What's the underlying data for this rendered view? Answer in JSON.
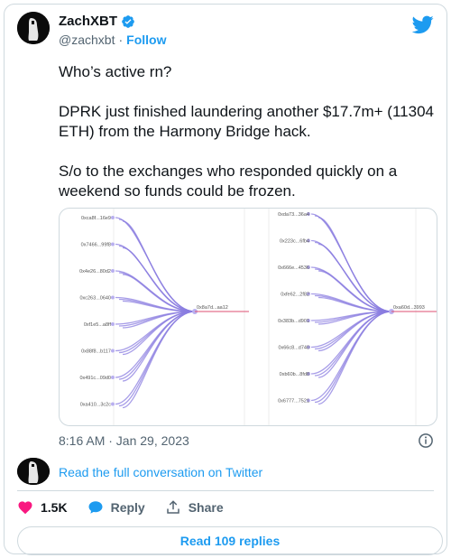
{
  "author": {
    "name": "ZachXBT",
    "handle": "@zachxbt",
    "separator": "·",
    "follow_label": "Follow"
  },
  "tweet": {
    "paragraphs": [
      "Who’s active rn?",
      "DPRK just finished laundering another $17.7m+ (11304 ETH) from the Harmony Bridge hack.",
      "S/o to the exchanges who responded quickly on a weekend so funds could be frozen."
    ]
  },
  "media": {
    "left_graph": {
      "sources": [
        "0xca8f...16e9",
        "0x7466...99f8",
        "0x4e26...80d2",
        "0xc263...0640",
        "0xf1e5...a8ff",
        "0x88f8...b117",
        "0x491c...09d0",
        "0xa410...3c2c"
      ],
      "target": "0x8a7d...aa12"
    },
    "right_graph": {
      "sources": [
        "0xda73...36a4",
        "0x223c...6fb4",
        "0x666e...4536",
        "0xfe62...2f82",
        "0x383b...d901",
        "0x66c8...d740",
        "0xb60b...8fd8",
        "0x6777...7521"
      ],
      "target": "0xa60d...3993"
    },
    "colors": {
      "edge": "#8b7ee0",
      "target_edge": "#e05a7a",
      "node": "#b9b0f0"
    }
  },
  "meta": {
    "timestamp": "8:16 AM · Jan 29, 2023",
    "conversation_link": "Read the full conversation on Twitter"
  },
  "actions": {
    "likes": "1.5K",
    "reply_label": "Reply",
    "share_label": "Share",
    "read_replies": "Read 109 replies"
  },
  "colors": {
    "accent": "#1d9bf0",
    "like": "#f91880"
  }
}
